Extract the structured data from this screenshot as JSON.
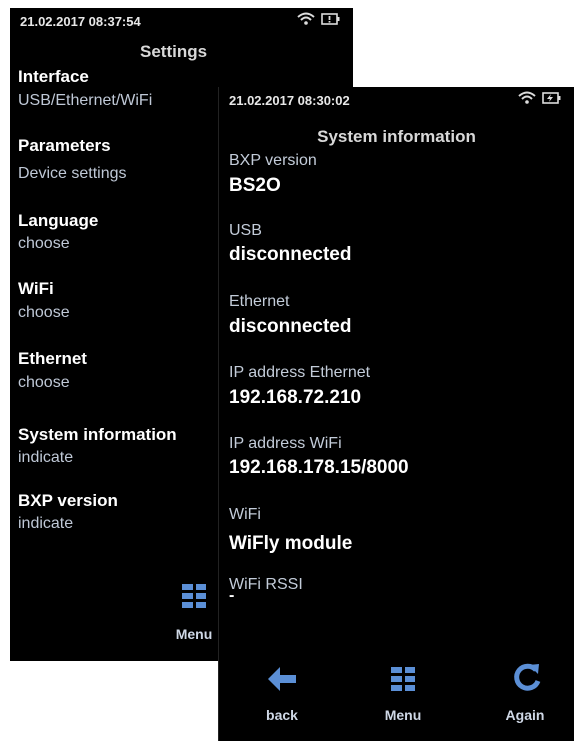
{
  "back_screen": {
    "status": {
      "time": "21.02.2017 08:37:54"
    },
    "title": "Settings",
    "items": [
      {
        "label": "Interface",
        "sub": "USB/Ethernet/WiFi"
      },
      {
        "label": "Parameters",
        "sub": "Device settings"
      },
      {
        "label": "Language",
        "sub": "choose"
      },
      {
        "label": "WiFi",
        "sub": "choose"
      },
      {
        "label": "Ethernet",
        "sub": "choose"
      },
      {
        "label": "System information",
        "sub": "indicate"
      },
      {
        "label": "BXP version",
        "sub": "indicate"
      }
    ],
    "menu_label": "Menu"
  },
  "front_screen": {
    "status": {
      "time": "21.02.2017 08:30:02"
    },
    "title": "System information",
    "fields": [
      {
        "label": "BXP version",
        "value": "BS2O"
      },
      {
        "label": "USB",
        "value": "disconnected"
      },
      {
        "label": "Ethernet",
        "value": "disconnected"
      },
      {
        "label": "IP address Ethernet",
        "value": "192.168.72.210"
      },
      {
        "label": "IP address WiFi",
        "value": "192.168.178.15/8000"
      },
      {
        "label": "WiFi",
        "value": "WiFly  module"
      },
      {
        "label": "WiFi RSSI",
        "value": "-"
      }
    ],
    "nav": {
      "back": "back",
      "menu": "Menu",
      "again": "Again"
    }
  },
  "colors": {
    "accent": "#5b8fd6",
    "background": "#000000"
  },
  "icons": [
    "wifi-icon",
    "battery-icon",
    "menu-grid-icon",
    "back-arrow-icon",
    "refresh-icon"
  ]
}
